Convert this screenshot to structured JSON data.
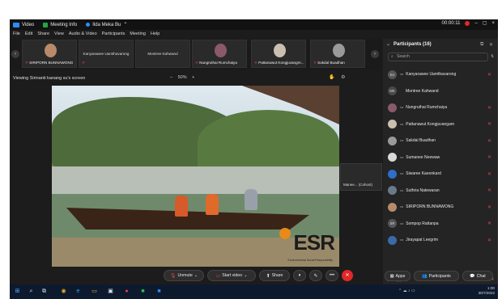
{
  "titlebar": {
    "app_label": "Video",
    "meeting_info": "Meeting Info",
    "share_info": "Ilda Meka Bu",
    "time": "00:00:11",
    "controls": [
      "–",
      "▢",
      "×"
    ]
  },
  "menubar": [
    "File",
    "Edit",
    "Share",
    "View",
    "Audio & Video",
    "Participants",
    "Meeting",
    "Help"
  ],
  "thumbnails": [
    {
      "name": "SIRIPORN BUNNAWONG",
      "type": "photo",
      "avatar_color": "#b98a6a",
      "muted": true
    },
    {
      "name": "Kanyarawee Uamthavarong",
      "type": "name",
      "muted": true
    },
    {
      "name": "Montree Kahwand",
      "type": "name",
      "muted": false
    },
    {
      "name": "Nungruthai Rumchaiya",
      "type": "photo",
      "avatar_color": "#8a5a6a",
      "muted": true
    },
    {
      "name": "Pattanawut Kongjuvangre...",
      "type": "photo",
      "avatar_color": "#c9c0b0",
      "muted": true
    },
    {
      "name": "Sakdal Buadhan",
      "type": "photo",
      "avatar_color": "#9a9a9a",
      "muted": true
    }
  ],
  "viewing": {
    "label": "Viewing Sirinanti kanang su's screen",
    "zoom": "50%",
    "zoom_minus": "–",
    "zoom_plus": "+"
  },
  "video": {
    "logo": "ESR",
    "logo_sub": "Environmental Social Responsibility"
  },
  "floating_tile": "Manee... (Cohost)",
  "toolbar": {
    "unmute": "Unmute",
    "start_video": "Start video",
    "share": "Share",
    "end_icon": "✕"
  },
  "panel": {
    "title": "Participants (16)",
    "search_placeholder": "Search",
    "participants": [
      {
        "name": "Kanyarawee Uamthavarong",
        "initials": "KU",
        "avatar_color": "#555555",
        "host": false
      },
      {
        "name": "Montree Kahwand",
        "initials": "MK",
        "avatar_color": "#4a4a4a",
        "host": false
      },
      {
        "name": "Nungruthai Rumchaiya",
        "initials": "",
        "avatar_color": "#8a5a6a",
        "host": true
      },
      {
        "name": "Pattanawut Kongjuvangam",
        "initials": "",
        "avatar_color": "#c9c0b0",
        "host": true
      },
      {
        "name": "Sakdal Buadhan",
        "initials": "",
        "avatar_color": "#9a9a9a",
        "host": true
      },
      {
        "name": "Sumanee Neewaw",
        "initials": "",
        "avatar_color": "#d8d8d8",
        "host": true
      },
      {
        "name": "Siwaree Kaeonkard",
        "initials": "",
        "avatar_color": "#2d6fc9",
        "host": true
      },
      {
        "name": "Suthira Natewaran",
        "initials": "",
        "avatar_color": "#6a7a8a",
        "host": true
      },
      {
        "name": "SIRIPORN BUNNAWONG",
        "initials": "",
        "avatar_color": "#b98a6a",
        "host": true
      },
      {
        "name": "Sompop Rattanpa",
        "initials": "SR",
        "avatar_color": "#555555",
        "host": true
      },
      {
        "name": "Jirayapat Leegrim",
        "initials": "",
        "avatar_color": "#3a6aa8",
        "host": true
      }
    ],
    "apps_title": "Apps"
  },
  "right_buttons": {
    "apps": "Apps",
    "participants": "Participants",
    "chat": "Chat"
  },
  "taskbar": {
    "time": "1:00",
    "date": "30/7/2022"
  }
}
